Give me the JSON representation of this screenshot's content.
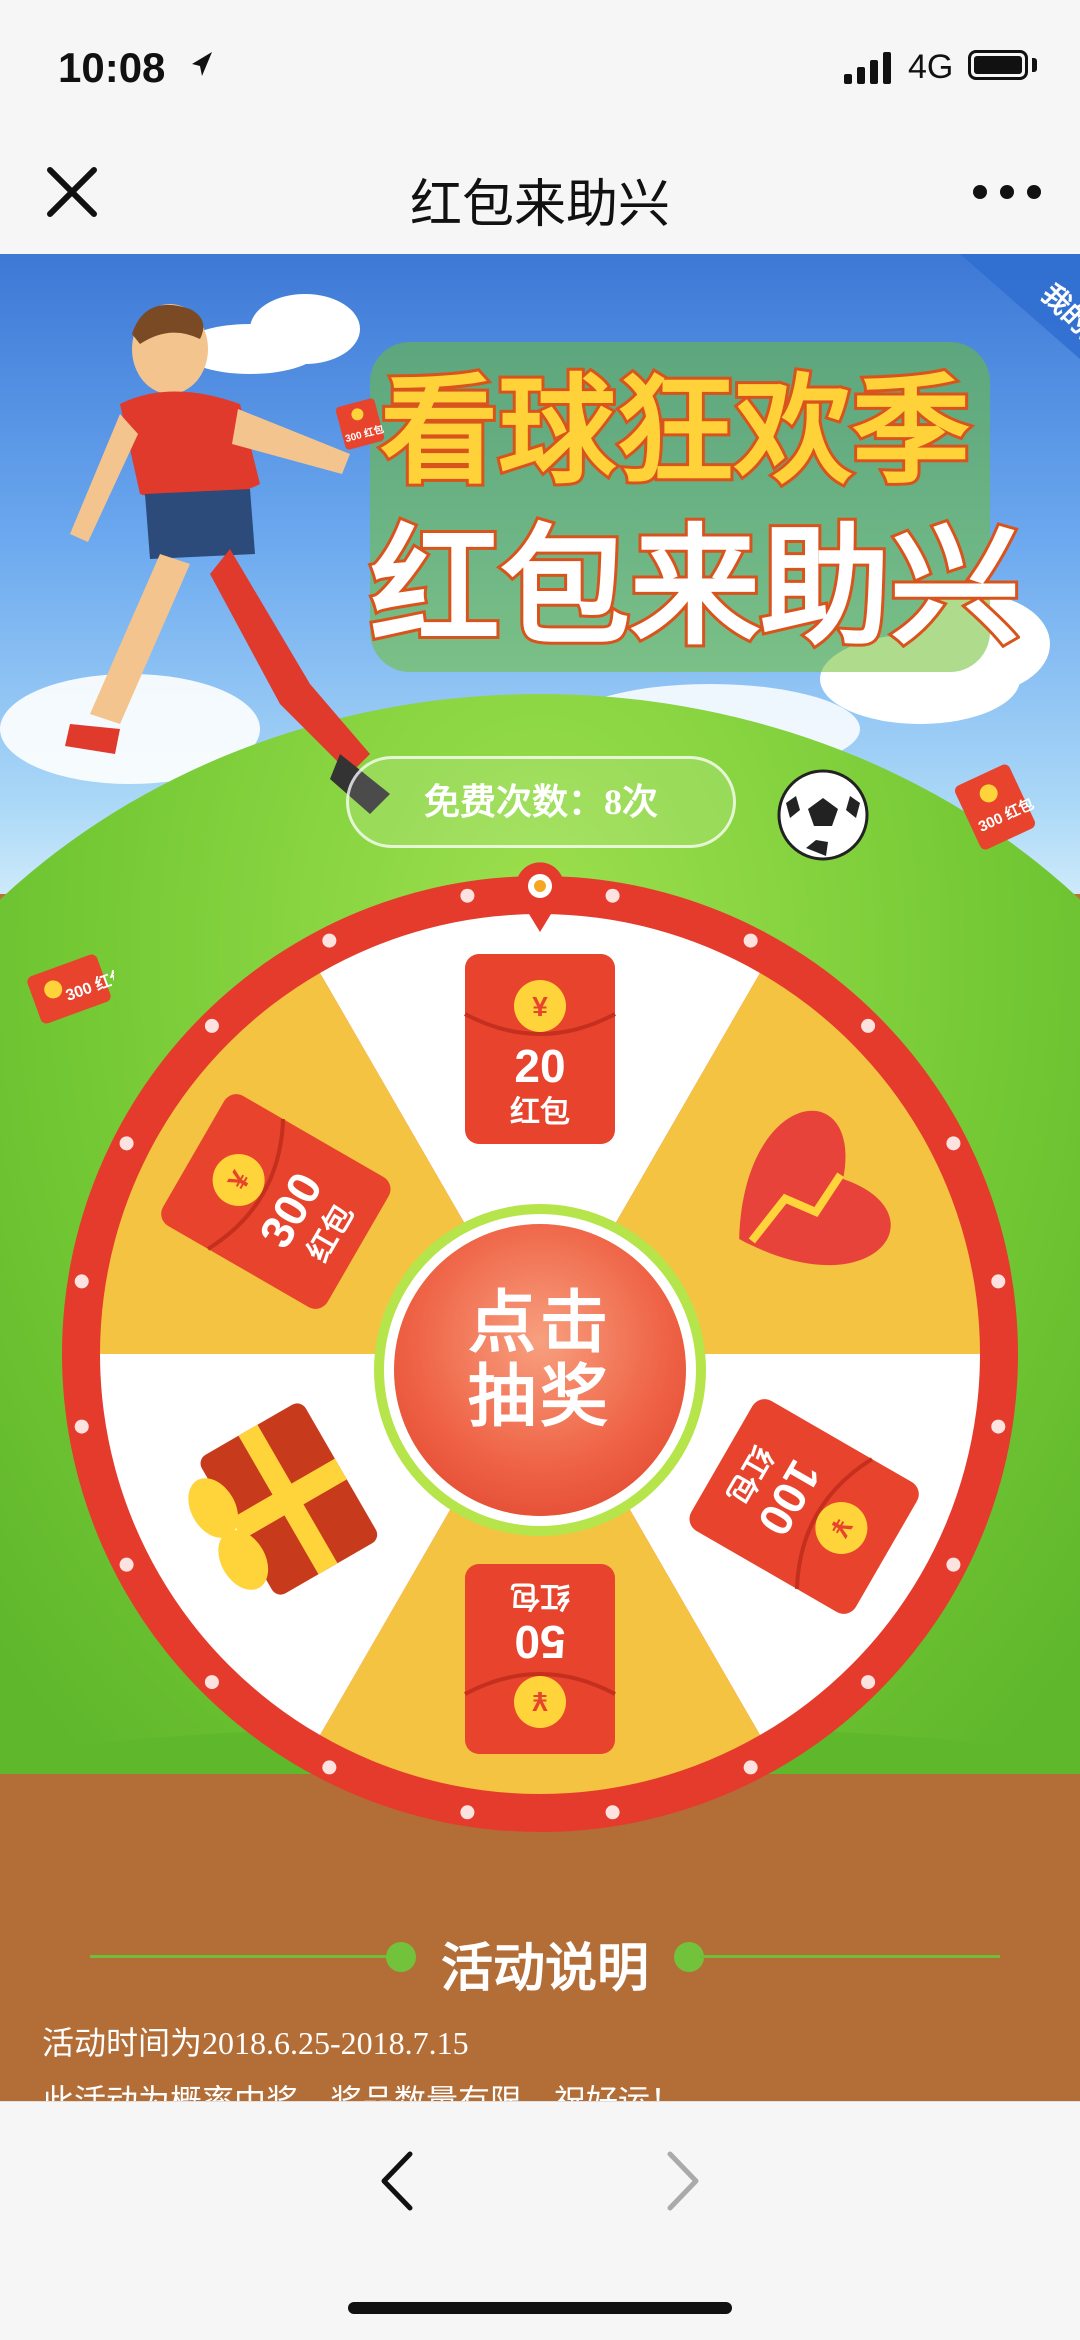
{
  "status_bar": {
    "time": "10:08",
    "network": "4G"
  },
  "nav": {
    "title": "红包来助兴"
  },
  "banner": {
    "title_line1": "看球狂欢季",
    "title_line2": "红包来助兴",
    "prizes_tab": "我的奖品"
  },
  "free_count": "免费次数：8次",
  "floating_envelopes": [
    {
      "label": "300 红包"
    },
    {
      "label": "300 红包"
    },
    {
      "label": "300 红包"
    }
  ],
  "wheel": {
    "center_line1": "点击",
    "center_line2": "抽奖",
    "segments": [
      {
        "prize": "20",
        "unit": "红包",
        "icon": "red-envelope-icon"
      },
      {
        "prize": "",
        "unit": "",
        "icon": "broken-heart-icon"
      },
      {
        "prize": "100",
        "unit": "红包",
        "icon": "red-envelope-icon"
      },
      {
        "prize": "50",
        "unit": "红包",
        "icon": "red-envelope-icon"
      },
      {
        "prize": "",
        "unit": "",
        "icon": "gift-box-icon"
      },
      {
        "prize": "300",
        "unit": "红包",
        "icon": "red-envelope-icon"
      }
    ],
    "colors": {
      "rim": "#e53b2c",
      "yellow": "#f5c342",
      "white": "#ffffff",
      "envelope": "#e8432c",
      "coin": "#ffd43a"
    }
  },
  "rules": {
    "title": "活动说明",
    "line1": "活动时间为2018.6.25-2018.7.15",
    "line2": "此活动为概率中奖，奖品数量有限，祝好运！"
  }
}
